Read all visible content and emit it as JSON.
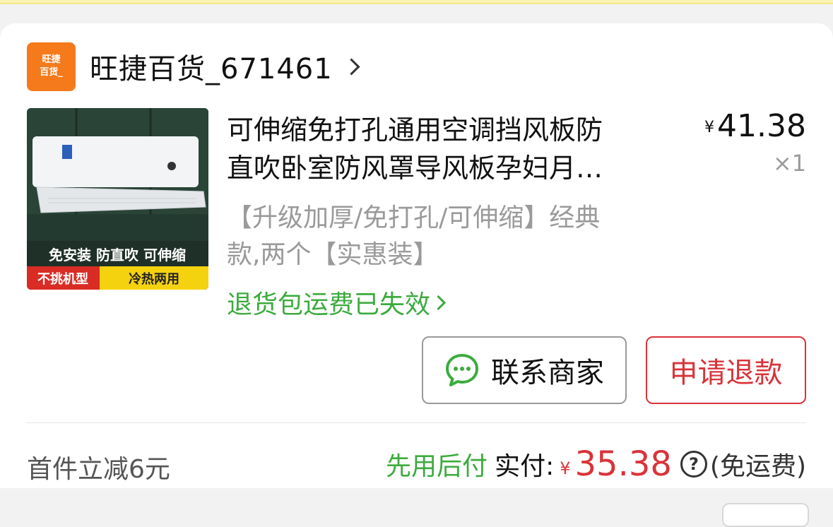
{
  "store": {
    "logo_line1": "旺捷",
    "logo_line2": "百货_",
    "name": "旺捷百货_671461"
  },
  "product": {
    "title_line1": "可伸缩免打孔通用空调挡风板防",
    "title_line2": "直吹卧室防风罩导风板孕妇月…",
    "price_symbol": "¥",
    "price": "41.38",
    "quantity": "×1",
    "spec_line1": "【升级加厚/免打孔/可伸缩】经典",
    "spec_line2": "款,两个【实惠装】",
    "return_status": "退货包运费已失效",
    "image_text": {
      "slogan": "免安装 防直吹 可伸缩",
      "tag_left": "不挑机型",
      "tag_right": "冷热两用"
    }
  },
  "actions": {
    "contact_label": "联系商家",
    "refund_label": "申请退款"
  },
  "summary": {
    "discount": "首件立减6元",
    "pay_later": "先用后付",
    "paid_label": "实付:",
    "paid_symbol": "¥",
    "paid_amount": "35.38",
    "help_glyph": "?",
    "shipping_note": "(免运费)"
  },
  "colors": {
    "accent_red": "#d9333a",
    "accent_green": "#3cab3e",
    "store_logo": "#f47a1c"
  }
}
